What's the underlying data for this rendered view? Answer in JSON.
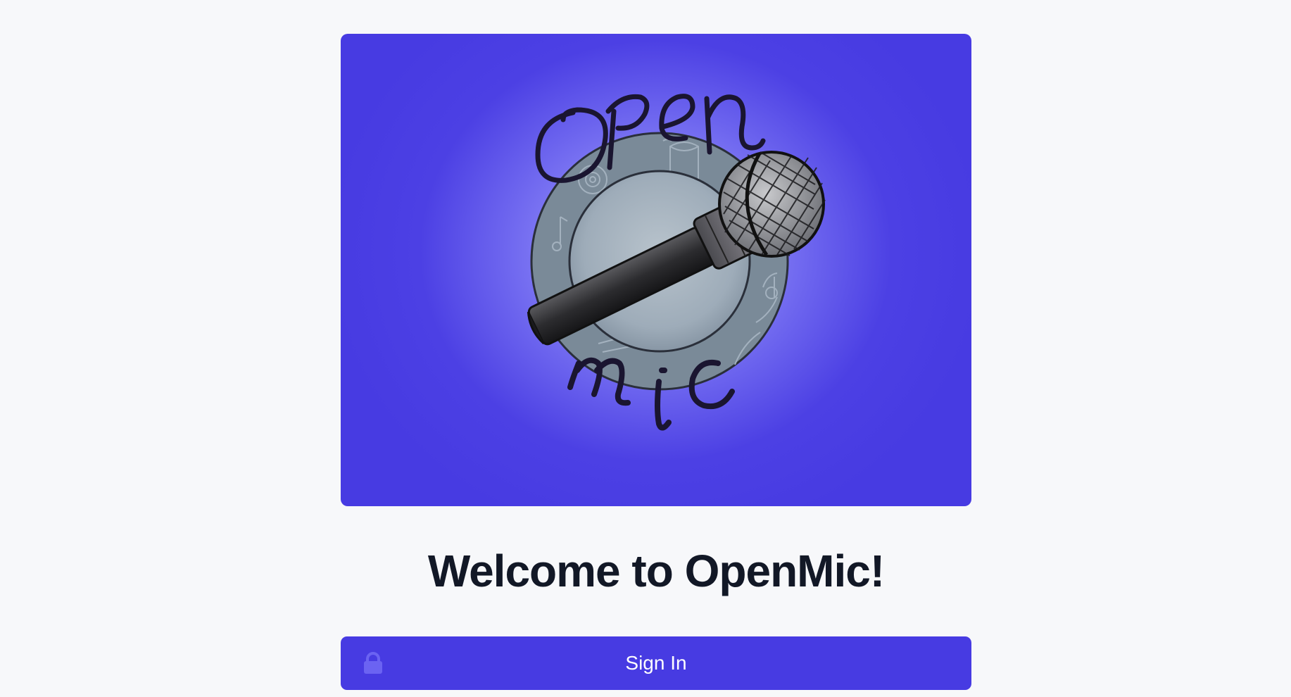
{
  "hero": {
    "logo_text_top": "Open",
    "logo_text_bottom": "mic"
  },
  "welcome": {
    "title": "Welcome to OpenMic!"
  },
  "signin": {
    "label": "Sign In",
    "icon": "lock-icon"
  },
  "colors": {
    "accent": "#473be2",
    "background": "#f7f8fa",
    "title_text": "#121826"
  }
}
